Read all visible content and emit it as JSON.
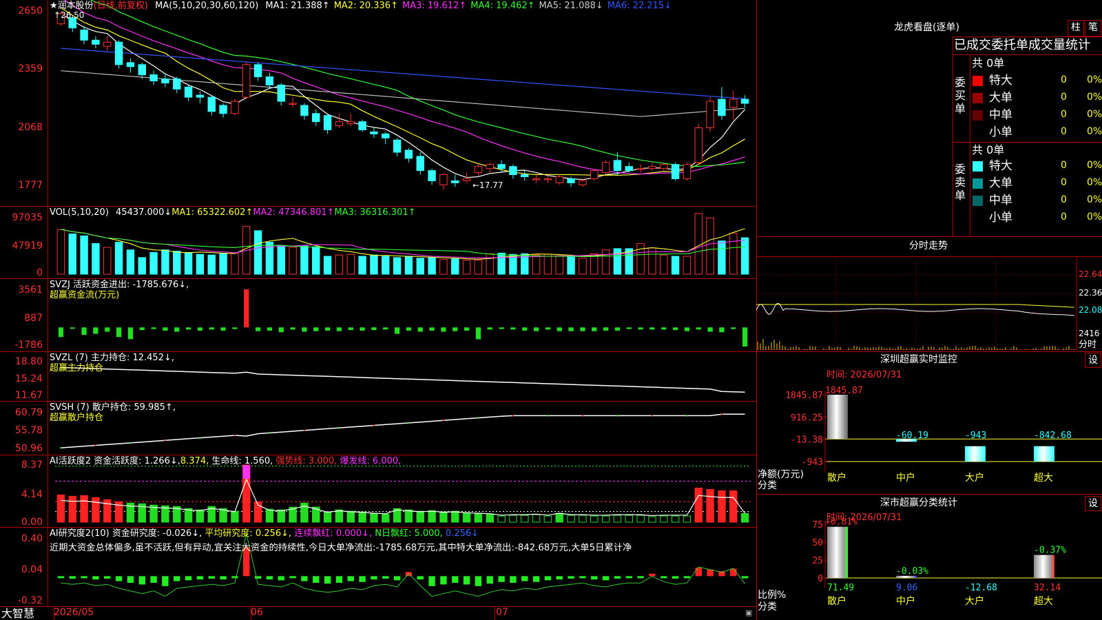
{
  "header": {
    "star": "★",
    "stock_name": "润本股份",
    "period": "(日线,前复权)",
    "ma_set": "MA(5,10,20,30,60,120)",
    "ma": [
      {
        "label": "MA1: 21.388↑",
        "color": "#ffffff"
      },
      {
        "label": "MA2: 20.336↑",
        "color": "#ffff33"
      },
      {
        "label": "MA3: 19.612↑",
        "color": "#ff33ff"
      },
      {
        "label": "MA4: 19.462↑",
        "color": "#33ff33"
      },
      {
        "label": "MA5: 21.088↓",
        "color": "#cccccc"
      },
      {
        "label": "MA6: 22.215↓",
        "color": "#3355ff"
      }
    ],
    "high_mark": "26.50",
    "low_mark": "←17.77"
  },
  "price_axis": [
    "2650",
    "2359",
    "2068",
    "1777"
  ],
  "vol_header": {
    "label": "VOL(5,10,20)",
    "val": "45437.000↓",
    "ma1": "MA1: 65322.602↑",
    "ma2": "MA2: 47346.801↑",
    "ma3": "MA3: 36316.301↑"
  },
  "vol_axis": [
    "97035",
    "47919",
    "0"
  ],
  "svzj": {
    "title": "SVZJ  活跃资金进出: -1785.676↓,",
    "sub": "超赢资金流(万元)",
    "axis": [
      "3561",
      "887",
      "-1786"
    ]
  },
  "svzl": {
    "title": "SVZL (7) 主力持仓: 12.452↓,",
    "sub": "超赢主力持仓",
    "axis": [
      "18.80",
      "15.24",
      "11.67"
    ]
  },
  "svsh": {
    "title": "SVSH (7) 散户持仓: 59.985↑,",
    "sub": "超赢散户持仓",
    "axis": [
      "60.79",
      "55.78",
      "50.96"
    ]
  },
  "ai1": {
    "title": "AI活跃度2 资金活跃度: 1.266↓,",
    "v2": "8.374,",
    "life": "生命线: 1.560,",
    "strong": "强势线: 3.000,",
    "burst": "爆发线: 6.000,",
    "axis": [
      "8.37",
      "4.14",
      "0.00"
    ]
  },
  "ai2": {
    "title": "AI研究度2(10) 资金研究度: -0.026↓,",
    "avg": "平均研究度: 0.256↓,",
    "cont": "连续飘红: 0.000↓,",
    "nday": "N日飘红: 5.000,",
    "last": "0.256↓",
    "desc": "近期大资金总体偏多,虽不活跃,但有异动,宜关注大资金的持续性,今日大单净流出:-1785.68万元,其中特大单净流出:-842.68万元,大单5日累计净",
    "axis": [
      "0.40",
      "0.04",
      "-0.32"
    ]
  },
  "xaxis": {
    "brand": "大智慧",
    "m1": "2026/05",
    "m2": "06",
    "m3": "07"
  },
  "lhb": {
    "title": "龙虎看盘(逐单)",
    "btn1": "柱",
    "btn2": "笔",
    "header": "已成交委托单成交量统计",
    "buy_label": "委买单",
    "sell_label": "委卖单",
    "buy_total": "共 0单",
    "sell_total": "共 0单",
    "buy_rows": [
      {
        "name": "特大",
        "val": "0",
        "pct": "0%",
        "color": "#ff0000"
      },
      {
        "name": "大单",
        "val": "0",
        "pct": "0%",
        "color": "#990000"
      },
      {
        "name": "中单",
        "val": "0",
        "pct": "0%",
        "color": "#660000"
      },
      {
        "name": "小单",
        "val": "0",
        "pct": "0%",
        "color": ""
      }
    ],
    "sell_rows": [
      {
        "name": "特大",
        "val": "0",
        "pct": "0%",
        "color": "#33ffff"
      },
      {
        "name": "大单",
        "val": "0",
        "pct": "0%",
        "color": "#009999"
      },
      {
        "name": "中单",
        "val": "0",
        "pct": "0%",
        "color": "#006666"
      },
      {
        "name": "小单",
        "val": "0",
        "pct": "0%",
        "color": ""
      }
    ]
  },
  "intraday": {
    "title": "分时走势",
    "axis": [
      "22.64",
      "22.36",
      "22.08"
    ],
    "vol_val": "2416",
    "vol_label": "分时"
  },
  "sz_monitor": {
    "title": "深圳超赢实时监控",
    "btn": "设",
    "time": "时间: 2026/07/31",
    "axis": [
      "1845.87",
      "916.25",
      "-13.38",
      "-943"
    ],
    "unit": "净额(万元)",
    "cat_label": "分类",
    "bars": [
      {
        "cat": "散户",
        "val": 1845.87,
        "label": "1845.87"
      },
      {
        "cat": "中户",
        "val": -60.19,
        "label": "-60.19"
      },
      {
        "cat": "大户",
        "val": -943,
        "label": "-943"
      },
      {
        "cat": "超大",
        "val": -842.68,
        "label": "-842.68"
      }
    ]
  },
  "sh_stats": {
    "title": "深市超赢分类统计",
    "btn": "设",
    "time": "时间: 2026/07/31",
    "axis": [
      "75",
      "50",
      "25",
      "0"
    ],
    "unit": "比例%",
    "cat_label": "分类",
    "bars": [
      {
        "cat": "散户",
        "val": 71.49,
        "top": "+0.81%",
        "bottom": "71.49"
      },
      {
        "cat": "中户",
        "val": 9.06,
        "top": "-0.03%",
        "bottom": "9.06"
      },
      {
        "cat": "大户",
        "val": -12.68,
        "top": "",
        "bottom": "-12.68"
      },
      {
        "cat": "超大",
        "val": 32.14,
        "top": "-0.37%",
        "bottom": "32.14"
      }
    ]
  },
  "chart_data": {
    "type": "candlestick",
    "title": "润本股份 (日线,前复权)",
    "ylim": [
      17.2,
      26.8
    ],
    "high": 26.5,
    "low": 17.77,
    "candles": [
      [
        25.9,
        26.4,
        26.5,
        25.8
      ],
      [
        26.2,
        25.7,
        26.3,
        25.5
      ],
      [
        25.6,
        25.1,
        25.8,
        24.9
      ],
      [
        25.1,
        24.9,
        25.3,
        24.7
      ],
      [
        24.8,
        25.0,
        25.3,
        24.6
      ],
      [
        25.0,
        23.9,
        25.1,
        23.7
      ],
      [
        24.0,
        23.8,
        24.2,
        23.5
      ],
      [
        23.9,
        23.4,
        24.0,
        23.2
      ],
      [
        23.4,
        23.1,
        23.6,
        22.9
      ],
      [
        23.2,
        23.0,
        23.5,
        22.8
      ],
      [
        23.2,
        22.7,
        23.3,
        22.5
      ],
      [
        22.8,
        22.3,
        22.9,
        22.1
      ],
      [
        22.4,
        22.3,
        22.6,
        22.0
      ],
      [
        22.3,
        21.6,
        22.4,
        21.4
      ],
      [
        21.9,
        21.5,
        22.0,
        21.3
      ],
      [
        21.5,
        22.1,
        22.2,
        21.4
      ],
      [
        22.3,
        23.9,
        24.0,
        22.2
      ],
      [
        23.9,
        23.3,
        24.0,
        23.1
      ],
      [
        23.3,
        22.9,
        23.5,
        22.7
      ],
      [
        22.9,
        22.1,
        23.0,
        21.9
      ],
      [
        22.0,
        22.0,
        22.3,
        21.8
      ],
      [
        21.9,
        21.4,
        22.0,
        21.2
      ],
      [
        21.5,
        21.1,
        21.7,
        20.9
      ],
      [
        21.4,
        20.7,
        21.5,
        20.5
      ],
      [
        20.9,
        21.1,
        21.5,
        20.8
      ],
      [
        21.0,
        21.1,
        21.5,
        20.9
      ],
      [
        21.1,
        20.7,
        21.2,
        20.6
      ],
      [
        20.6,
        20.5,
        20.8,
        20.3
      ],
      [
        20.5,
        20.3,
        20.6,
        20.0
      ],
      [
        20.2,
        19.6,
        20.3,
        19.4
      ],
      [
        19.7,
        19.3,
        19.8,
        19.1
      ],
      [
        19.4,
        18.7,
        19.6,
        18.5
      ],
      [
        18.7,
        18.2,
        18.8,
        18.0
      ],
      [
        18.0,
        18.5,
        18.6,
        17.77
      ],
      [
        18.2,
        18.1,
        18.5,
        17.9
      ],
      [
        18.2,
        18.3,
        18.6,
        18.1
      ],
      [
        18.6,
        18.9,
        19.0,
        18.4
      ],
      [
        18.8,
        19.0,
        19.1,
        18.6
      ],
      [
        19.0,
        18.8,
        19.2,
        18.6
      ],
      [
        18.9,
        18.5,
        19.0,
        18.3
      ],
      [
        18.5,
        18.4,
        18.7,
        18.2
      ],
      [
        18.3,
        18.3,
        18.5,
        18.1
      ],
      [
        18.3,
        18.3,
        18.5,
        18.1
      ],
      [
        18.1,
        18.4,
        18.5,
        18.0
      ],
      [
        18.3,
        18.1,
        18.4,
        17.9
      ],
      [
        18.0,
        18.2,
        18.3,
        17.9
      ],
      [
        18.3,
        18.7,
        18.8,
        18.2
      ],
      [
        18.6,
        19.1,
        19.2,
        18.5
      ],
      [
        19.2,
        18.7,
        19.6,
        18.5
      ],
      [
        18.9,
        18.7,
        19.1,
        18.6
      ],
      [
        18.8,
        18.8,
        19.0,
        18.6
      ],
      [
        18.8,
        18.9,
        19.1,
        18.7
      ],
      [
        18.8,
        19.0,
        19.1,
        18.7
      ],
      [
        19.0,
        18.3,
        19.1,
        18.2
      ],
      [
        18.3,
        19.0,
        19.1,
        18.2
      ],
      [
        19.1,
        20.8,
        21.0,
        19.0
      ],
      [
        20.8,
        22.1,
        22.3,
        20.6
      ],
      [
        22.2,
        21.4,
        22.8,
        21.2
      ],
      [
        21.8,
        22.2,
        22.6,
        21.2
      ],
      [
        22.2,
        22.0,
        22.4,
        21.8
      ]
    ],
    "volume": [
      70,
      63,
      60,
      48,
      42,
      50,
      38,
      26,
      34,
      38,
      36,
      34,
      31,
      30,
      33,
      33,
      75,
      68,
      50,
      45,
      42,
      44,
      43,
      28,
      30,
      31,
      28,
      30,
      28,
      26,
      28,
      25,
      26,
      23,
      24,
      22,
      22,
      32,
      33,
      31,
      32,
      30,
      31,
      29,
      27,
      25,
      32,
      38,
      40,
      40,
      48,
      41,
      30,
      28,
      28,
      95,
      88,
      52,
      64,
      57
    ],
    "svzj": [
      -900,
      -120,
      -700,
      -600,
      -400,
      -900,
      -1100,
      -250,
      -150,
      -300,
      -400,
      -200,
      -300,
      -200,
      -300,
      -150,
      3561,
      -350,
      -300,
      -450,
      -200,
      -400,
      -350,
      -300,
      -350,
      -250,
      -300,
      -250,
      -200,
      -600,
      -300,
      -400,
      -300,
      -400,
      -350,
      -300,
      -1100,
      -200,
      -150,
      -200,
      -300,
      -350,
      -200,
      -350,
      -350,
      -350,
      -350,
      -300,
      -300,
      -150,
      -200,
      -200,
      -200,
      -250,
      -350,
      -200,
      -400,
      -450,
      -150,
      -1786
    ],
    "ai1": [
      4.0,
      3.8,
      3.9,
      3.6,
      3.3,
      3.0,
      2.8,
      2.7,
      2.5,
      2.4,
      2.3,
      2.0,
      1.8,
      2.3,
      2.0,
      1.6,
      8.37,
      3.0,
      1.9,
      1.8,
      2.2,
      2.8,
      2.2,
      1.5,
      1.8,
      1.6,
      1.5,
      1.3,
      1.2,
      2.0,
      1.8,
      1.6,
      1.7,
      1.5,
      1.6,
      1.4,
      1.3,
      1.2,
      0.9,
      1.0,
      1.0,
      1.1,
      0.9,
      1.3,
      1.0,
      1.0,
      0.9,
      0.9,
      1.0,
      1.0,
      1.0,
      0.8,
      0.9,
      0.9,
      0.9,
      5.0,
      4.8,
      4.6,
      4.6,
      1.27
    ],
    "ai2": [
      -0.02,
      -0.03,
      -0.02,
      -0.04,
      -0.03,
      -0.06,
      -0.08,
      -0.1,
      -0.08,
      -0.12,
      -0.06,
      -0.05,
      -0.04,
      -0.03,
      -0.04,
      -0.02,
      0.35,
      -0.03,
      -0.04,
      -0.05,
      -0.02,
      -0.06,
      -0.08,
      -0.09,
      -0.08,
      -0.06,
      -0.07,
      -0.04,
      -0.03,
      -0.05,
      0.05,
      -0.04,
      -0.12,
      -0.1,
      -0.08,
      -0.1,
      -0.12,
      -0.09,
      -0.07,
      -0.08,
      -0.06,
      -0.07,
      -0.05,
      -0.04,
      -0.03,
      -0.02,
      -0.04,
      -0.05,
      -0.03,
      -0.02,
      -0.02,
      0.03,
      -0.01,
      -0.03,
      -0.02,
      0.1,
      0.08,
      0.06,
      0.09,
      -0.026
    ]
  }
}
